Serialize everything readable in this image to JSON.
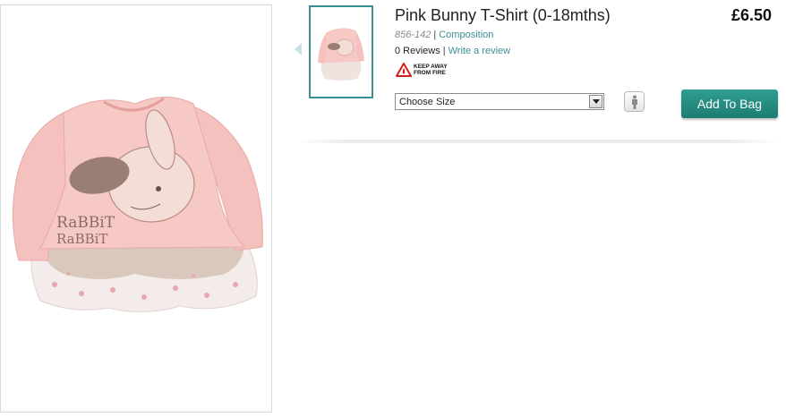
{
  "product": {
    "title": "Pink Bunny T-Shirt (0-18mths)",
    "price": "£6.50",
    "item_code": "856-142",
    "composition_link": "Composition",
    "reviews_count": "0 Reviews",
    "write_review_link": "Write a review",
    "warning_line1": "KEEP AWAY",
    "warning_line2": "FROM FIRE"
  },
  "size_select": {
    "selected": "Choose Size"
  },
  "buttons": {
    "add_to_bag": "Add To Bag"
  },
  "images": {
    "main_alt": "Pink bunny long-sleeve t-shirt with tutu hem",
    "main_print_1": "RaBBiT",
    "main_print_2": "RaBBiT"
  },
  "icons": {
    "thumb_nav": "chevron-left-icon",
    "warning": "fire-warning-icon",
    "size_guide": "person-silhouette-icon",
    "select": "dropdown-arrow-icon"
  },
  "colors": {
    "accent": "#3a8f95",
    "button": "#238278",
    "shirt_pink": "#f5c1be"
  }
}
